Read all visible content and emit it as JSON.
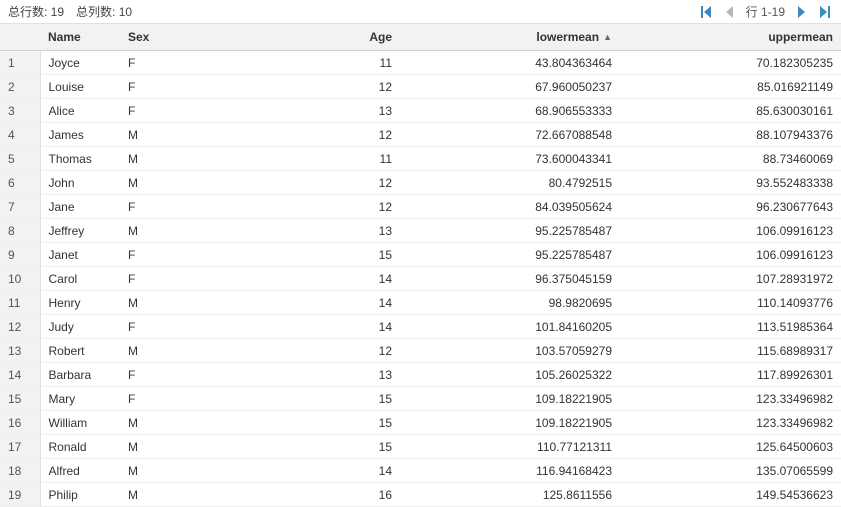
{
  "toolbar": {
    "total_rows_label": "总行数: 19",
    "total_cols_label": "总列数: 10",
    "row_range_label": "行 1-19"
  },
  "columns": {
    "name": "Name",
    "sex": "Sex",
    "age": "Age",
    "lowermean": "lowermean",
    "uppermean": "uppermean"
  },
  "sort": {
    "column": "lowermean",
    "indicator": "▲"
  },
  "rows": [
    {
      "n": "1",
      "name": "Joyce",
      "sex": "F",
      "age": "11",
      "lowermean": "43.804363464",
      "uppermean": "70.182305235"
    },
    {
      "n": "2",
      "name": "Louise",
      "sex": "F",
      "age": "12",
      "lowermean": "67.960050237",
      "uppermean": "85.016921149"
    },
    {
      "n": "3",
      "name": "Alice",
      "sex": "F",
      "age": "13",
      "lowermean": "68.906553333",
      "uppermean": "85.630030161"
    },
    {
      "n": "4",
      "name": "James",
      "sex": "M",
      "age": "12",
      "lowermean": "72.667088548",
      "uppermean": "88.107943376"
    },
    {
      "n": "5",
      "name": "Thomas",
      "sex": "M",
      "age": "11",
      "lowermean": "73.600043341",
      "uppermean": "88.73460069"
    },
    {
      "n": "6",
      "name": "John",
      "sex": "M",
      "age": "12",
      "lowermean": "80.4792515",
      "uppermean": "93.552483338"
    },
    {
      "n": "7",
      "name": "Jane",
      "sex": "F",
      "age": "12",
      "lowermean": "84.039505624",
      "uppermean": "96.230677643"
    },
    {
      "n": "8",
      "name": "Jeffrey",
      "sex": "M",
      "age": "13",
      "lowermean": "95.225785487",
      "uppermean": "106.09916123"
    },
    {
      "n": "9",
      "name": "Janet",
      "sex": "F",
      "age": "15",
      "lowermean": "95.225785487",
      "uppermean": "106.09916123"
    },
    {
      "n": "10",
      "name": "Carol",
      "sex": "F",
      "age": "14",
      "lowermean": "96.375045159",
      "uppermean": "107.28931972"
    },
    {
      "n": "11",
      "name": "Henry",
      "sex": "M",
      "age": "14",
      "lowermean": "98.9820695",
      "uppermean": "110.14093776"
    },
    {
      "n": "12",
      "name": "Judy",
      "sex": "F",
      "age": "14",
      "lowermean": "101.84160205",
      "uppermean": "113.51985364"
    },
    {
      "n": "13",
      "name": "Robert",
      "sex": "M",
      "age": "12",
      "lowermean": "103.57059279",
      "uppermean": "115.68989317"
    },
    {
      "n": "14",
      "name": "Barbara",
      "sex": "F",
      "age": "13",
      "lowermean": "105.26025322",
      "uppermean": "117.89926301"
    },
    {
      "n": "15",
      "name": "Mary",
      "sex": "F",
      "age": "15",
      "lowermean": "109.18221905",
      "uppermean": "123.33496982"
    },
    {
      "n": "16",
      "name": "William",
      "sex": "M",
      "age": "15",
      "lowermean": "109.18221905",
      "uppermean": "123.33496982"
    },
    {
      "n": "17",
      "name": "Ronald",
      "sex": "M",
      "age": "15",
      "lowermean": "110.77121311",
      "uppermean": "125.64500603"
    },
    {
      "n": "18",
      "name": "Alfred",
      "sex": "M",
      "age": "14",
      "lowermean": "116.94168423",
      "uppermean": "135.07065599"
    },
    {
      "n": "19",
      "name": "Philip",
      "sex": "M",
      "age": "16",
      "lowermean": "125.8611556",
      "uppermean": "149.54536623"
    }
  ]
}
